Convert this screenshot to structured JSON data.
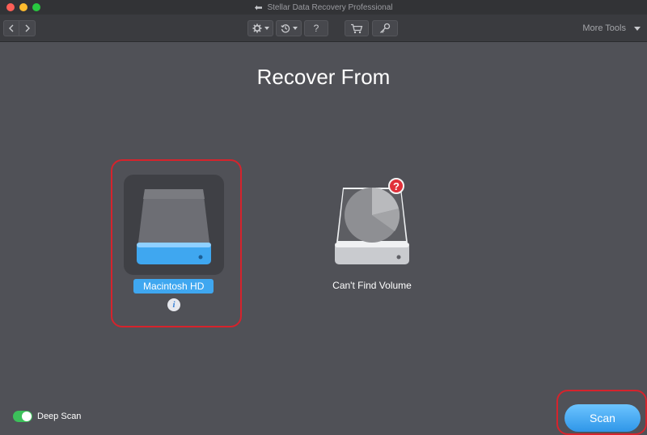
{
  "window": {
    "title": "Stellar Data Recovery Professional",
    "traffic_lights": [
      "#fe5f57",
      "#febc2e",
      "#28c840"
    ]
  },
  "toolbar": {
    "back_icon": "chevron-left-icon",
    "forward_icon": "chevron-right-icon",
    "settings_icon": "gear-icon",
    "history_icon": "history-icon",
    "help_label": "?",
    "cart_icon": "cart-icon",
    "key_icon": "key-icon",
    "more_tools_label": "More Tools"
  },
  "main": {
    "heading": "Recover From",
    "drives": [
      {
        "label": "Macintosh HD",
        "selected": true,
        "info_label": "i",
        "accent": "#3fa7f0"
      },
      {
        "label": "Can't Find Volume",
        "selected": false,
        "badge_label": "?",
        "badge_color": "#e0303a"
      }
    ]
  },
  "footer": {
    "deep_scan_label": "Deep Scan",
    "deep_scan_on": true,
    "scan_label": "Scan"
  },
  "colors": {
    "background": "#505157",
    "accent": "#3fa7f0",
    "highlight_outline": "#d6232c",
    "toggle_on": "#3cc05a"
  }
}
